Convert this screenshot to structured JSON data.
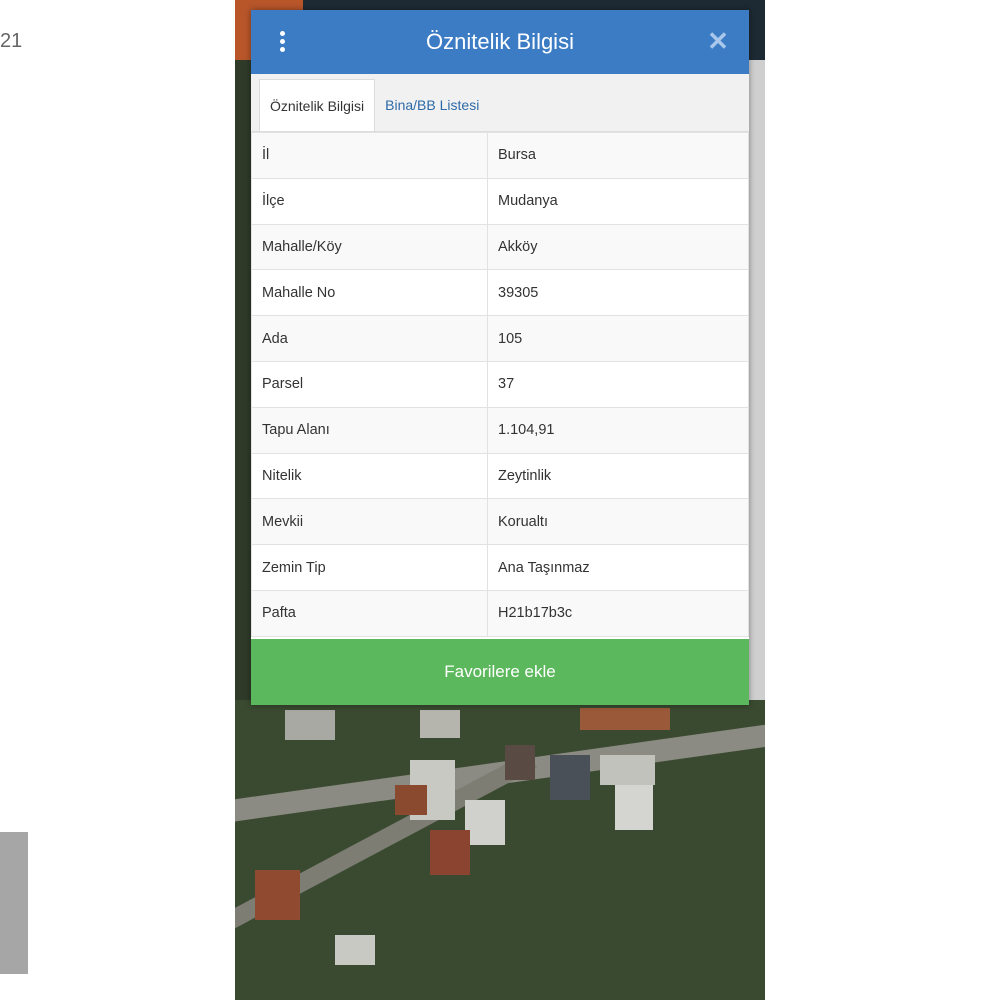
{
  "corner_text": "21",
  "panel": {
    "title": "Öznitelik Bilgisi",
    "tabs": [
      {
        "label": "Öznitelik Bilgisi",
        "active": true
      },
      {
        "label": "Bina/BB Listesi",
        "active": false
      }
    ],
    "rows": [
      {
        "key": "İl",
        "value": "Bursa"
      },
      {
        "key": "İlçe",
        "value": "Mudanya"
      },
      {
        "key": "Mahalle/Köy",
        "value": "Akköy"
      },
      {
        "key": "Mahalle No",
        "value": "39305"
      },
      {
        "key": "Ada",
        "value": "105"
      },
      {
        "key": "Parsel",
        "value": "37"
      },
      {
        "key": "Tapu Alanı",
        "value": "1.104,91"
      },
      {
        "key": "Nitelik",
        "value": "Zeytinlik"
      },
      {
        "key": "Mevkii",
        "value": "Korualtı"
      },
      {
        "key": "Zemin Tip",
        "value": "Ana Taşınmaz"
      },
      {
        "key": "Pafta",
        "value": "H21b17b3c"
      }
    ],
    "favorite_button": "Favorilere ekle"
  },
  "colors": {
    "header_blue": "#3b7cc4",
    "button_green": "#5cb85c",
    "tab_link_blue": "#2d6aa8"
  },
  "icons": [
    "more-vertical-icon",
    "close-icon"
  ]
}
